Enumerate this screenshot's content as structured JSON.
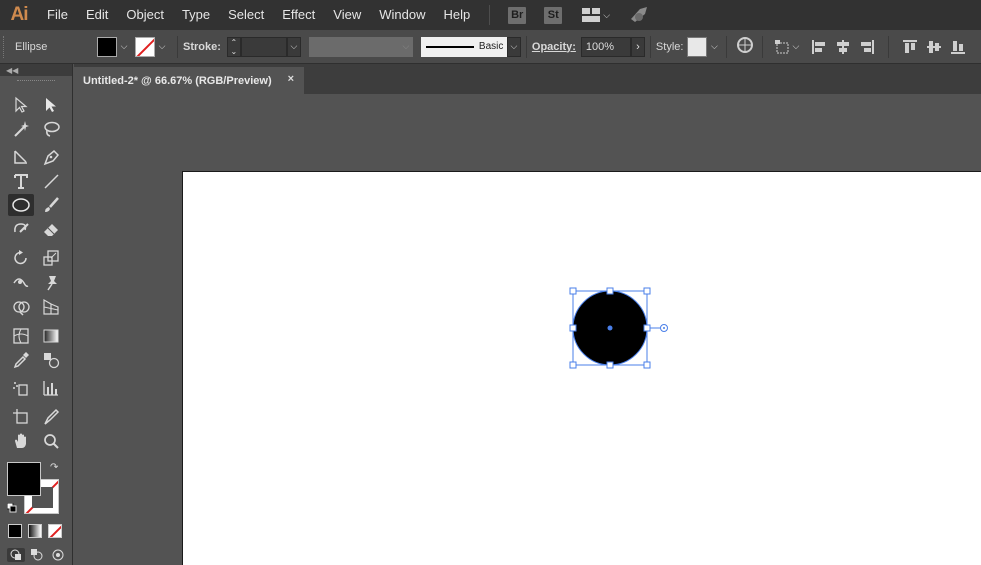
{
  "app": {
    "logo": "Ai"
  },
  "menu": [
    "File",
    "Edit",
    "Object",
    "Type",
    "Select",
    "Effect",
    "View",
    "Window",
    "Help"
  ],
  "bridge_badge": "Br",
  "stock_badge": "St",
  "control": {
    "selection_type": "Ellipse",
    "stroke_label": "Stroke:",
    "brush_label": "Basic",
    "opacity_label": "Opacity:",
    "opacity_value": "100%",
    "style_label": "Style:"
  },
  "document": {
    "tab_title": "Untitled-2* @ 66.67% (RGB/Preview)",
    "close_glyph": "×"
  },
  "colors": {
    "fill": "#000000",
    "stroke": "none",
    "selection": "#4a7fe8",
    "accent_logo": "#cf8a4e"
  }
}
